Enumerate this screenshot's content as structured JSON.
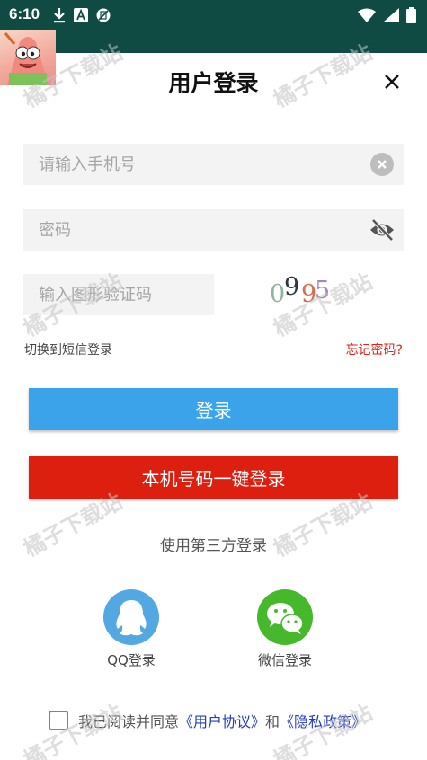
{
  "status_bar": {
    "time": "6:10",
    "left_icons": [
      "download-icon",
      "font-a-icon",
      "no-sim-icon"
    ],
    "right_icons": [
      "wifi-icon",
      "signal-icon",
      "battery-icon"
    ]
  },
  "header": {
    "title": "用户登录",
    "close_icon": "close-icon"
  },
  "form": {
    "phone_placeholder": "请输入手机号",
    "password_placeholder": "密码",
    "captcha_placeholder": "输入图形验证码",
    "captcha_chars": [
      "0",
      "9",
      "9",
      "5"
    ],
    "sms_login_label": "切换到短信登录",
    "forgot_password_label": "忘记密码?"
  },
  "buttons": {
    "login": "登录",
    "one_key_login": "本机号码一键登录"
  },
  "third_party": {
    "title": "使用第三方登录",
    "qq_label": "QQ登录",
    "wechat_label": "微信登录"
  },
  "agreement": {
    "prefix": "我已阅读并同意",
    "user_agreement": "《用户协议》",
    "and": "和",
    "privacy_policy": "《隐私政策》"
  },
  "watermark": "橘子下载站",
  "colors": {
    "status_bar": "#0f4a43",
    "login_button": "#3ba3ea",
    "one_key_button": "#dc1f0f",
    "forgot_link": "#e0221b",
    "agreement_link": "#2238c9",
    "qq": "#53a8e2",
    "wechat": "#46b82b"
  }
}
